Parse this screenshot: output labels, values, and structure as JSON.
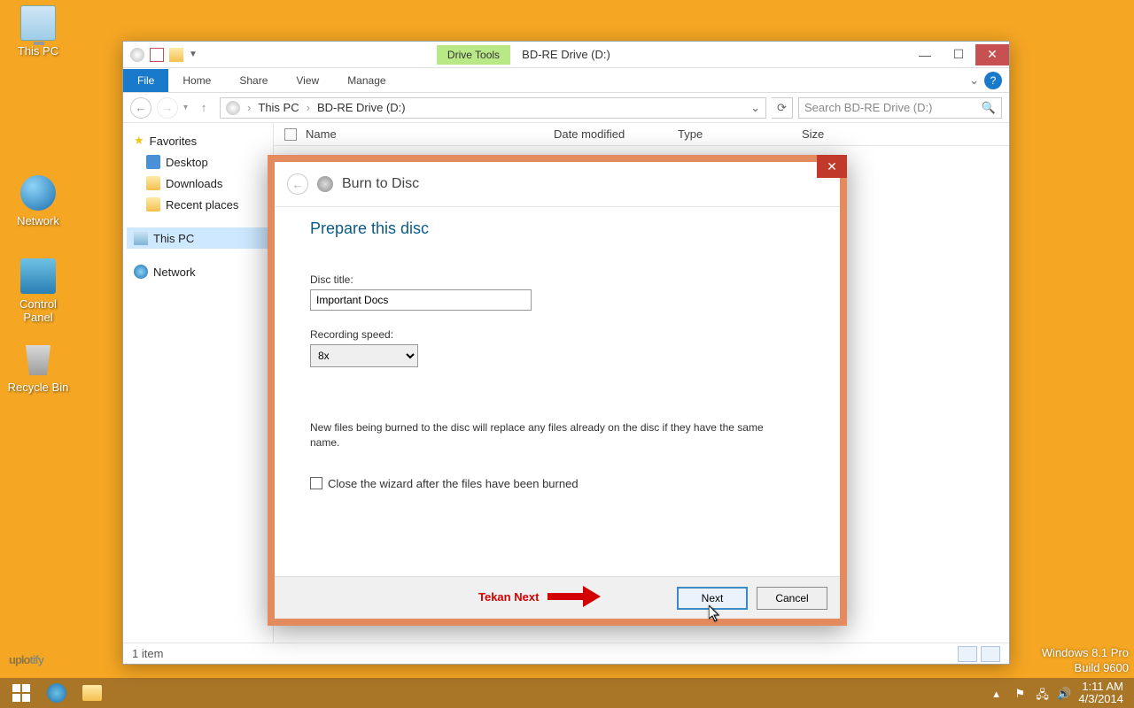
{
  "desktop": {
    "this_pc": "This PC",
    "network": "Network",
    "control_panel": "Control Panel",
    "recycle_bin": "Recycle Bin"
  },
  "explorer": {
    "context_tab": "Drive Tools",
    "window_title": "BD-RE Drive (D:)",
    "ribbon": {
      "file": "File",
      "home": "Home",
      "share": "Share",
      "view": "View",
      "manage": "Manage"
    },
    "breadcrumb": {
      "root": "This PC",
      "folder": "BD-RE Drive (D:)"
    },
    "search_placeholder": "Search BD-RE Drive (D:)",
    "columns": {
      "name": "Name",
      "date": "Date modified",
      "type": "Type",
      "size": "Size"
    },
    "nav": {
      "favorites": "Favorites",
      "desktop": "Desktop",
      "downloads": "Downloads",
      "recent": "Recent places",
      "this_pc": "This PC",
      "network": "Network"
    },
    "status": "1 item"
  },
  "dialog": {
    "title": "Burn to Disc",
    "heading": "Prepare this disc",
    "disc_title_label": "Disc title:",
    "disc_title_value": "Important Docs",
    "speed_label": "Recording speed:",
    "speed_value": "8x",
    "note": "New files being burned to the disc will replace any files already on the disc if they have the same name.",
    "close_wizard": "Close the wizard after the files have been burned",
    "next": "Next",
    "cancel": "Cancel"
  },
  "annotation": "Tekan Next",
  "watermark": {
    "p1": "uplo",
    "p2": "tify"
  },
  "system": {
    "os": "Windows 8.1 Pro",
    "build": "Build 9600",
    "time": "1:11 AM",
    "date": "4/3/2014"
  }
}
